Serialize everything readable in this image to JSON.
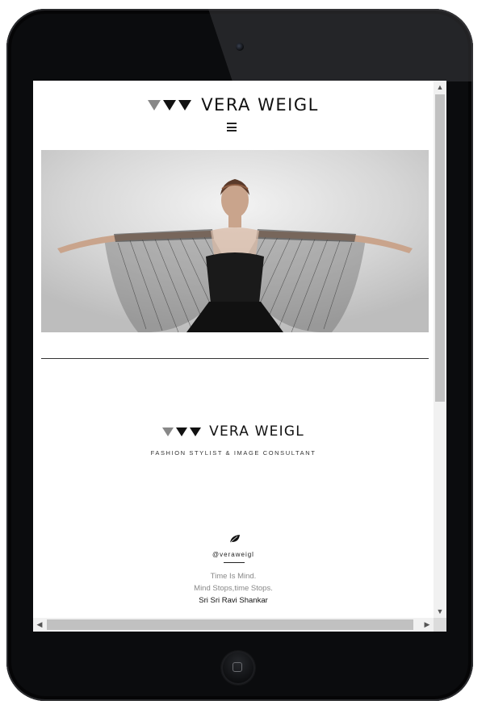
{
  "header": {
    "brand": "VERA WEIGL"
  },
  "hero": {
    "alt": "Model in black dress with sheer winged cape"
  },
  "intro": {
    "brand": "VERA WEIGL",
    "tagline": "FASHION STYLIST & IMAGE CONSULTANT"
  },
  "social": {
    "icon": "leaf-icon",
    "handle": "@veraweigl"
  },
  "quote": {
    "line1": "Time Is Mind.",
    "line2": "Mind Stops,time Stops.",
    "author": "Sri Sri Ravi Shankar"
  },
  "colors": {
    "device": "#0b0c0e",
    "text": "#111111",
    "muted": "#888888",
    "scrollbar_thumb": "#c1c1c1"
  }
}
